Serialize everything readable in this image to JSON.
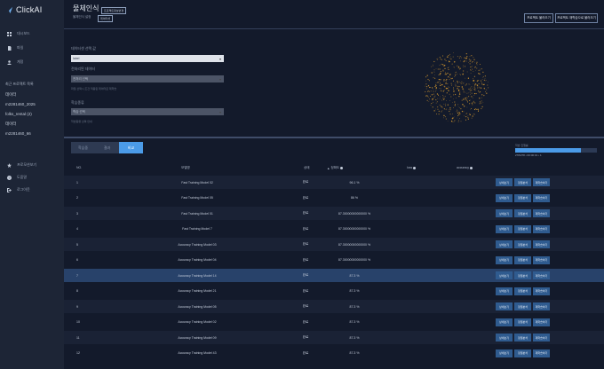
{
  "app": {
    "name": "ClickAI"
  },
  "sidebar": {
    "nav": [
      {
        "label": "대시보드",
        "icon": "grid-icon"
      },
      {
        "label": "파일",
        "icon": "file-icon"
      },
      {
        "label": "계정",
        "icon": "user-icon"
      }
    ],
    "recent_title": "최근 프로젝트 목록",
    "projects": [
      "데이터",
      "m2281460_2025",
      "folks_rental (2)",
      "데이터",
      "m2281460_66"
    ],
    "bottom": [
      {
        "label": "프로모션보기",
        "icon": "star-icon"
      },
      {
        "label": "도움말",
        "icon": "help-icon"
      },
      {
        "label": "로그아웃",
        "icon": "logout-icon"
      }
    ]
  },
  "header": {
    "title": "물체인식",
    "title_badge": "프로젝트정보변경",
    "subtitle": "물체인식 설정",
    "subtitle_badge": "데이터셋",
    "btn_load": "프로젝트 불러오기",
    "btn_retrain": "프로젝트 재학습으로 불러오기"
  },
  "form": {
    "field1_label": "데이터셋 선택 값",
    "field1_value": "label",
    "field2_label": "전처리된 데이터",
    "field2_value": "전처리 선택",
    "field2_help": "파일 선택시 조건 적용된 데이터로 재학습",
    "field3_label": "학습종류",
    "field3_value": "학습 선택",
    "field3_help": "학습종류 선택 안내"
  },
  "tabs": [
    "학습중",
    "결과",
    "비교"
  ],
  "progress": {
    "label": "학습 진행률",
    "value": 0.8,
    "text": "278/278 • 00:00:01 • 1"
  },
  "table": {
    "columns": [
      "NO.",
      "모델명",
      "상태",
      "정확도",
      "loss",
      "accuracy"
    ],
    "actions": [
      "상세보기",
      "정밀분석",
      "재학습하기"
    ],
    "rows": [
      {
        "no": "1",
        "name": "Fast Training Model 02",
        "status": "완료",
        "accuracy": "96.1 %",
        "selected": false
      },
      {
        "no": "2",
        "name": "Fast Training Model 05",
        "status": "완료",
        "accuracy": "86 %",
        "selected": false
      },
      {
        "no": "3",
        "name": "Fast Training Model 01",
        "status": "완료",
        "accuracy": "87.30000000000000 %",
        "selected": false
      },
      {
        "no": "4",
        "name": "Fast Training Model 7",
        "status": "완료",
        "accuracy": "87.30000000000000 %",
        "selected": false
      },
      {
        "no": "5",
        "name": "Accuracy Training Model 03",
        "status": "완료",
        "accuracy": "87.30000000000000 %",
        "selected": false
      },
      {
        "no": "6",
        "name": "Accuracy Training Model 04",
        "status": "완료",
        "accuracy": "87.30000000000000 %",
        "selected": false
      },
      {
        "no": "7",
        "name": "Accuracy Training Model 14",
        "status": "완료",
        "accuracy": "87.3 %",
        "selected": true
      },
      {
        "no": "8",
        "name": "Accuracy Training Model 21",
        "status": "완료",
        "accuracy": "87.3 %",
        "selected": false
      },
      {
        "no": "9",
        "name": "Accuracy Training Model 05",
        "status": "완료",
        "accuracy": "87.3 %",
        "selected": false
      },
      {
        "no": "10",
        "name": "Accuracy Training Model 02",
        "status": "완료",
        "accuracy": "87.3 %",
        "selected": false
      },
      {
        "no": "11",
        "name": "Accuracy Training Model 09",
        "status": "완료",
        "accuracy": "87.3 %",
        "selected": false
      },
      {
        "no": "12",
        "name": "Accuracy Training Model 43",
        "status": "완료",
        "accuracy": "87.3 %",
        "selected": false
      }
    ]
  },
  "colors": {
    "accent": "#4b9be8",
    "sidebar": "#1d2536",
    "background": "#131a2b",
    "dots": "#e0a030"
  }
}
